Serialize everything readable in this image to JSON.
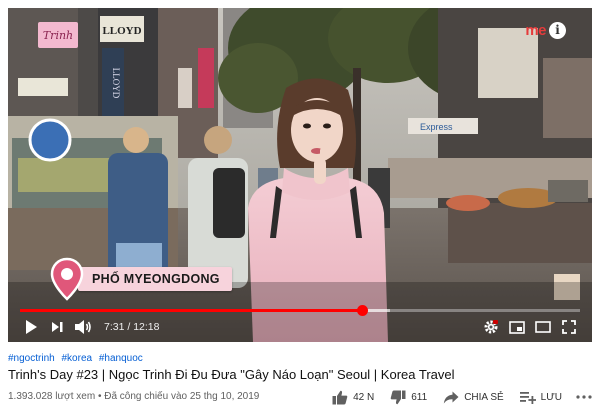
{
  "player": {
    "watermark_text": "Trinh",
    "brand_logo": "me",
    "location_label": "PHỐ MYEONGDONG",
    "current_time": "7:31",
    "duration": "12:18",
    "time_separator": " / ",
    "progress_played": 0.611,
    "progress_loaded": 0.66,
    "colors": {
      "progress": "#ff0000",
      "location_pin": "#e0577a"
    },
    "icons": {
      "play": "play-icon",
      "next": "next-icon",
      "volume": "volume-icon",
      "autoplay": "autoplay-toggle-icon",
      "settings": "gear-icon",
      "miniplayer": "miniplayer-icon",
      "theater": "theater-mode-icon",
      "fullscreen": "fullscreen-icon",
      "info": "info-icon"
    },
    "scene": {
      "shop_signs": [
        "LLOYD",
        "LLOYD"
      ],
      "street_sign": "Express"
    }
  },
  "video": {
    "hashtags": [
      "#ngoctrinh",
      "#korea",
      "#hanquoc"
    ],
    "title": "Trinh's Day #23 | Ngọc Trinh Đi Đu Đưa \"Gây Náo Loạn\" Seoul | Korea Travel",
    "views": "1.393.028 lượt xem",
    "meta_separator": " • ",
    "published": "Đã công chiếu vào 25 thg 10, 2019",
    "likes": "42 N",
    "dislikes": "611",
    "share_label": "CHIA SẺ",
    "save_label": "LƯU"
  }
}
